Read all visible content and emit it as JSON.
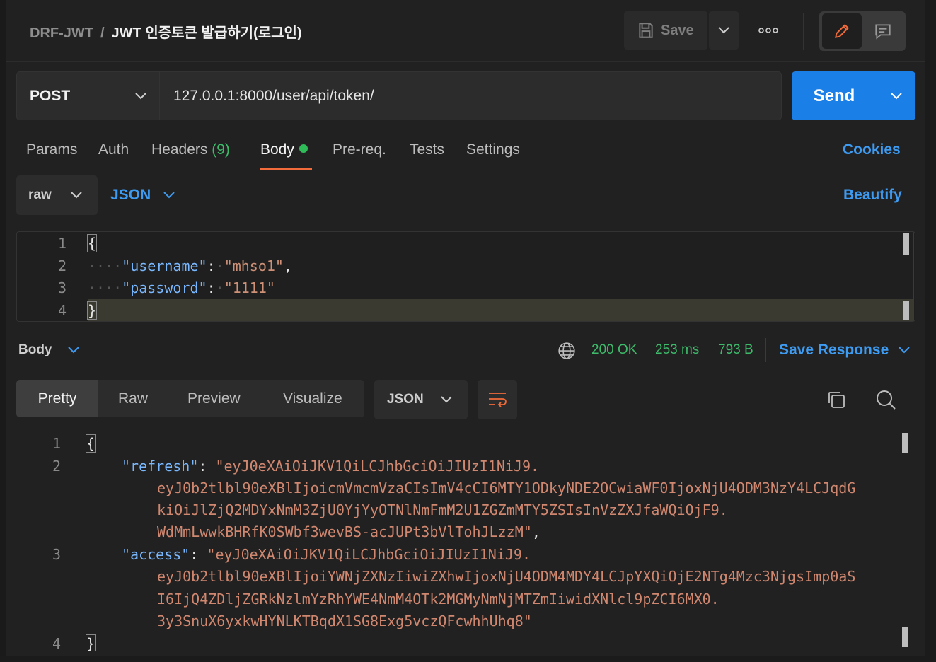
{
  "breadcrumb": {
    "collection": "DRF-JWT",
    "separator": "/",
    "request": "JWT 인증토큰 발급하기(로그인)"
  },
  "toolbar": {
    "save_label": "Save"
  },
  "request": {
    "method": "POST",
    "url": "127.0.0.1:8000/user/api/token/",
    "send_label": "Send"
  },
  "tabs": {
    "params": "Params",
    "auth": "Auth",
    "headers": "Headers",
    "headers_count": "(9)",
    "body": "Body",
    "prereq": "Pre-req.",
    "tests": "Tests",
    "settings": "Settings",
    "cookies": "Cookies"
  },
  "body_options": {
    "mode": "raw",
    "language": "JSON",
    "beautify": "Beautify"
  },
  "request_body": {
    "line_numbers": [
      "1",
      "2",
      "3",
      "4"
    ],
    "open_brace": "{",
    "close_brace": "}",
    "indent": "····",
    "username_key": "\"username\"",
    "username_value": "\"mhso1\"",
    "password_key": "\"password\"",
    "password_value": "\"1111\"",
    "colon": ":",
    "comma": ","
  },
  "response": {
    "section_label": "Body",
    "status": "200 OK",
    "time": "253 ms",
    "size": "793 B",
    "save_response": "Save Response",
    "views": [
      "Pretty",
      "Raw",
      "Preview",
      "Visualize"
    ],
    "format": "JSON",
    "line_numbers": [
      "1",
      "2",
      "3",
      "4"
    ],
    "open_brace": "{",
    "close_brace": "}",
    "refresh_key": "\"refresh\"",
    "refresh_lines": [
      "\"eyJ0eXAiOiJKV1QiLCJhbGciOiJIUzI1NiJ9.",
      "eyJ0b2tlbl90eXBlIjoicmVmcmVzaCIsImV4cCI6MTY1ODkyNDE2OCwiaWF0IjoxNjU4ODM3NzY4LCJqdG",
      "kiOiJlZjQ2MDYxNmM3ZjU0YjYyOTNlNmFmM2U1ZGZmMTY5ZSIsInVzZXJfaWQiOjF9.",
      "WdMmLwwkBHRfK0SWbf3wevBS-acJUPt3bVlTohJLzzM\""
    ],
    "access_key": "\"access\"",
    "access_lines": [
      "\"eyJ0eXAiOiJKV1QiLCJhbGciOiJIUzI1NiJ9.",
      "eyJ0b2tlbl90eXBlIjoiYWNjZXNzIiwiZXhwIjoxNjU4ODM4MDY4LCJpYXQiOjE2NTg4Mzc3NjgsImp0aS",
      "I6IjQ4ZDljZGRkNzlmYzRhYWE4NmM4OTk2MGMyNmNjMTZmIiwidXNlcl9pZCI6MX0.",
      "3y3SnuX6yxkwHYNLKTBqdX1SG8Exg5vczQFcwhhUhq8\""
    ]
  }
}
